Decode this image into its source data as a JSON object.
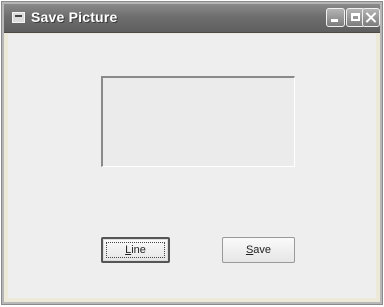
{
  "window": {
    "title": "Save Picture",
    "icon": "app-form-icon",
    "controls": {
      "minimize_icon": "minimize-icon",
      "maximize_icon": "maximize-icon",
      "close_icon": "close-icon"
    }
  },
  "buttons": {
    "line": {
      "accel": "L",
      "rest": "ine"
    },
    "save": {
      "accel": "S",
      "rest": "ave"
    }
  },
  "colors": {
    "titlebar": "#6e6e6e",
    "client": "#eeeeee"
  }
}
